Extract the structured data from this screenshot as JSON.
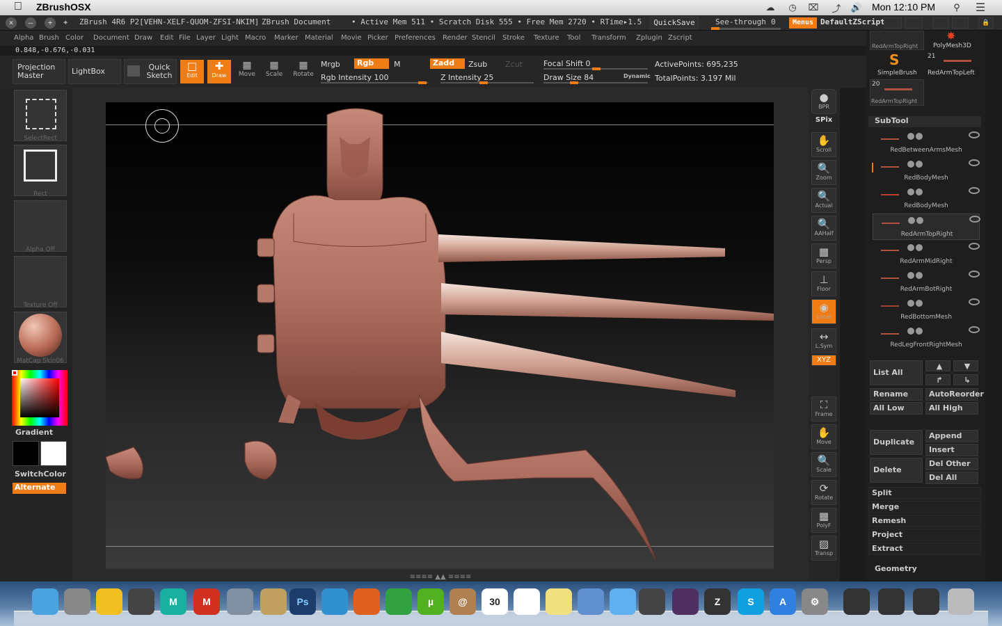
{
  "mac": {
    "app_name": "ZBrushOSX",
    "clock": "Mon 12:10 PM"
  },
  "titlebar": {
    "title": "ZBrush 4R6 P2[VEHN-XELF-QUOM-ZFSI-NKIM]",
    "doc": "ZBrush Document",
    "stats": "• Active Mem 511 • Scratch Disk 555 • Free Mem 2720 • RTime▸1.5",
    "quicksave": "QuickSave",
    "seethrough": "See-through",
    "seethrough_value": "0",
    "menus": "Menus",
    "script": "DefaultZScript"
  },
  "menu": [
    "Alpha",
    "Brush",
    "Color",
    "Document",
    "Draw",
    "Edit",
    "File",
    "Layer",
    "Light",
    "Macro",
    "Marker",
    "Material",
    "Movie",
    "Picker",
    "Preferences",
    "Render",
    "Stencil",
    "Stroke",
    "Texture",
    "Tool",
    "Transform",
    "Zplugin",
    "Zscript"
  ],
  "coords": "0.848,-0.676,-0.031",
  "toolbar": {
    "projection_master": "Projection Master",
    "lightbox": "LightBox",
    "quick_sketch": "Quick Sketch",
    "edit": "Edit",
    "draw": "Draw",
    "move": "Move",
    "scale": "Scale",
    "rotate": "Rotate",
    "mrgb": "Mrgb",
    "rgb": "Rgb",
    "m": "M",
    "zadd": "Zadd",
    "zsub": "Zsub",
    "zcut": "Zcut",
    "rgb_intensity": "Rgb Intensity 100",
    "z_intensity": "Z Intensity 25",
    "focal_shift": "Focal Shift 0",
    "draw_size": "Draw Size 84",
    "dynamic": "Dynamic",
    "active_points": "ActivePoints: 695,235",
    "total_points": "TotalPoints: 3.197 Mil"
  },
  "left": {
    "select_rect": "SelectRect",
    "rect": "Rect",
    "alpha_off": "Alpha  Off",
    "texture_off": "Texture  Off",
    "matcap": "MatCap  Skin06",
    "gradient": "Gradient",
    "switchcolor": "SwitchColor",
    "alternate": "Alternate"
  },
  "right_tools": [
    {
      "label": "BPR",
      "icon": "bpr-icon"
    },
    {
      "label": "SPix",
      "icon": "spix-icon"
    },
    {
      "label": "Scroll",
      "icon": "scroll-icon"
    },
    {
      "label": "Zoom",
      "icon": "zoom-icon"
    },
    {
      "label": "Actual",
      "icon": "actual-icon"
    },
    {
      "label": "AAHalf",
      "icon": "aahalf-icon"
    },
    {
      "label": "Persp",
      "icon": "persp-icon"
    },
    {
      "label": "Floor",
      "icon": "floor-icon"
    },
    {
      "label": "Local",
      "icon": "local-icon"
    },
    {
      "label": "L.Sym",
      "icon": "lsym-icon"
    },
    {
      "label": "XYZ",
      "icon": "xyz-icon"
    },
    {
      "label": "Frame",
      "icon": "frame-icon"
    },
    {
      "label": "Move",
      "icon": "move-icon"
    },
    {
      "label": "Scale",
      "icon": "scale-icon"
    },
    {
      "label": "Rotate",
      "icon": "rotate-icon"
    },
    {
      "label": "PolyF",
      "icon": "polyf-icon"
    },
    {
      "label": "Transp",
      "icon": "transp-icon"
    }
  ],
  "tools": {
    "top_left": "RedArmTopRight",
    "top_right": "PolyMesh3D",
    "mid_left": "SimpleBrush",
    "mid_right": "RedArmTopLeft",
    "count_21": "21",
    "count_20": "20",
    "bottom_left": "RedArmTopRight"
  },
  "subtool": {
    "header": "SubTool",
    "items": [
      "RedBetweenArmsMesh",
      "RedBodyMesh",
      "RedBodyMesh",
      "RedArmTopRight",
      "RedArmMidRight",
      "RedArmBotRight",
      "RedBottomMesh",
      "RedLegFrontRightMesh"
    ],
    "list_all": "List  All",
    "rename": "Rename",
    "autoreorder": "AutoReorder",
    "all_low": "All  Low",
    "all_high": "All  High",
    "duplicate": "Duplicate",
    "append": "Append",
    "insert": "Insert",
    "delete": "Delete",
    "del_other": "Del  Other",
    "del_all": "Del  All",
    "split": "Split",
    "merge": "Merge",
    "remesh": "Remesh",
    "project": "Project",
    "extract": "Extract",
    "geometry": "Geometry"
  },
  "dock": {
    "calendar_day": "30",
    "ps": "Ps"
  }
}
